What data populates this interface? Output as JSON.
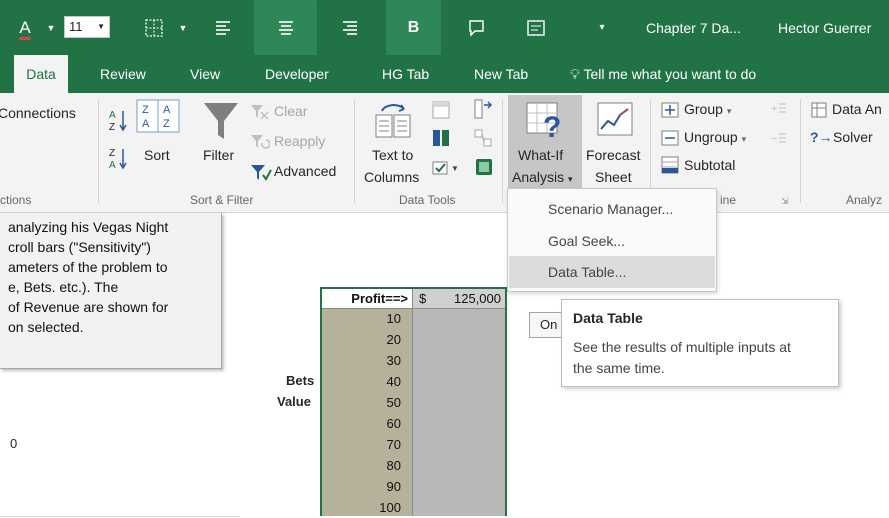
{
  "colors": {
    "brand": "#217346",
    "ribbon_bg": "#f3f3f3",
    "table_fill": "#b6b19b",
    "table_fill_right": "#b8b8b8"
  },
  "titlebar": {
    "font_color_letter": "A",
    "font_size": "11",
    "window_title": "Chapter 7 Da...",
    "user_name": "Hector Guerrer",
    "bold_label": "B",
    "icons": [
      "font-color-icon",
      "borders-icon",
      "align-left-icon",
      "align-center-icon",
      "align-right-icon",
      "bold-icon",
      "comment-icon",
      "form-icon",
      "customize-dropdown-icon"
    ]
  },
  "tabs": {
    "items": [
      "Data",
      "Review",
      "View",
      "Developer",
      "HG Tab",
      "New Tab"
    ],
    "selected": "Data",
    "tell_me": "Tell me what you want to do"
  },
  "ribbon": {
    "connections": {
      "label": "Connections",
      "group": "ctions"
    },
    "sort_filter": {
      "sort": "Sort",
      "filter": "Filter",
      "clear": "Clear",
      "reapply": "Reapply",
      "advanced": "Advanced",
      "group": "Sort & Filter"
    },
    "data_tools": {
      "text_to_columns_1": "Text to",
      "text_to_columns_2": "Columns",
      "group": "Data Tools"
    },
    "forecast": {
      "whatif_1": "What-If",
      "whatif_2": "Analysis",
      "forecast_1": "Forecast",
      "forecast_2": "Sheet"
    },
    "outline": {
      "group_btn": "Group",
      "ungroup_btn": "Ungroup",
      "subtotal": "Subtotal",
      "group": "ine"
    },
    "analyze": {
      "data_an": "Data An",
      "solver": "Solver",
      "group": "Analyz"
    }
  },
  "dropdown": {
    "items": [
      "Scenario Manager...",
      "Goal Seek...",
      "Data Table..."
    ],
    "highlighted": "Data Table..."
  },
  "tooltip": {
    "title": "Data Table",
    "line1": "See the results of multiple inputs at",
    "line2": "the same time."
  },
  "textbox": {
    "lines": [
      " analyzing his Vegas Night",
      "croll bars (\"Sensitivity\")",
      "ameters of the problem to",
      "e, Bets. etc.).  The",
      " of Revenue are shown for",
      "on selected."
    ]
  },
  "sheet": {
    "bets_label": "Bets",
    "value_label": "Value",
    "zero": "0",
    "partial_button": "On",
    "profit_header": "Profit==>",
    "currency": "$",
    "profit_value": "125,000",
    "bet_values": [
      "10",
      "20",
      "30",
      "40",
      "50",
      "60",
      "70",
      "80",
      "90",
      "100"
    ]
  }
}
